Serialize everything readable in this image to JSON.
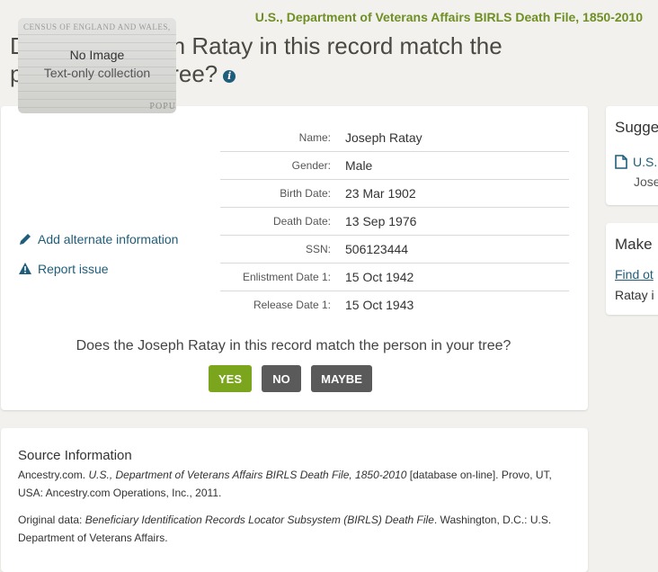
{
  "header": {
    "collection_title": "U.S., Department of Veterans Affairs BIRLS Death File, 1850-2010",
    "page_heading": "Does the Joseph Ratay in this record match the person in your tree?"
  },
  "record": {
    "image": {
      "census_caption": "CENSUS OF ENGLAND AND WALES,",
      "popu": "POPU",
      "no_image": "No Image",
      "text_only": "Text-only collection"
    },
    "add_alternate": "Add alternate information",
    "report_issue": "Report issue",
    "facts": [
      {
        "label": "Name:",
        "value": "Joseph Ratay"
      },
      {
        "label": "Gender:",
        "value": "Male"
      },
      {
        "label": "Birth Date:",
        "value": "23 Mar 1902"
      },
      {
        "label": "Death Date:",
        "value": "13 Sep 1976"
      },
      {
        "label": "SSN:",
        "value": "506123444"
      },
      {
        "label": "Enlistment Date 1:",
        "value": "15 Oct 1942"
      },
      {
        "label": "Release Date 1:",
        "value": "15 Oct 1943"
      }
    ],
    "match_question": "Does the Joseph Ratay in this record match the person in your tree?",
    "buttons": {
      "yes": "YES",
      "no": "NO",
      "maybe": "MAYBE"
    }
  },
  "source": {
    "heading": "Source Information",
    "citation_prefix": "Ancestry.com.",
    "citation_title": "U.S., Department of Veterans Affairs BIRLS Death File, 1850-2010",
    "citation_suffix": "[database on-line]. Provo, UT, USA: Ancestry.com Operations, Inc., 2011.",
    "original_prefix": "Original data:",
    "original_title": "Beneficiary Identification Records Locator Subsystem (BIRLS) Death File",
    "original_suffix": ". Washington, D.C.: U.S. Department of Veterans Affairs."
  },
  "sidebar": {
    "suggested_heading": "Sugge",
    "suggested_link": "U.S.",
    "suggested_sub": "Jose",
    "make_heading": "Make",
    "find_link": "Find ot",
    "ratay_text": "Ratay i"
  },
  "colors": {
    "accent_green": "#6f8f24",
    "link_blue": "#1f5d7a",
    "yes_green": "#7aa51c",
    "button_gray": "#5a5a5a"
  }
}
